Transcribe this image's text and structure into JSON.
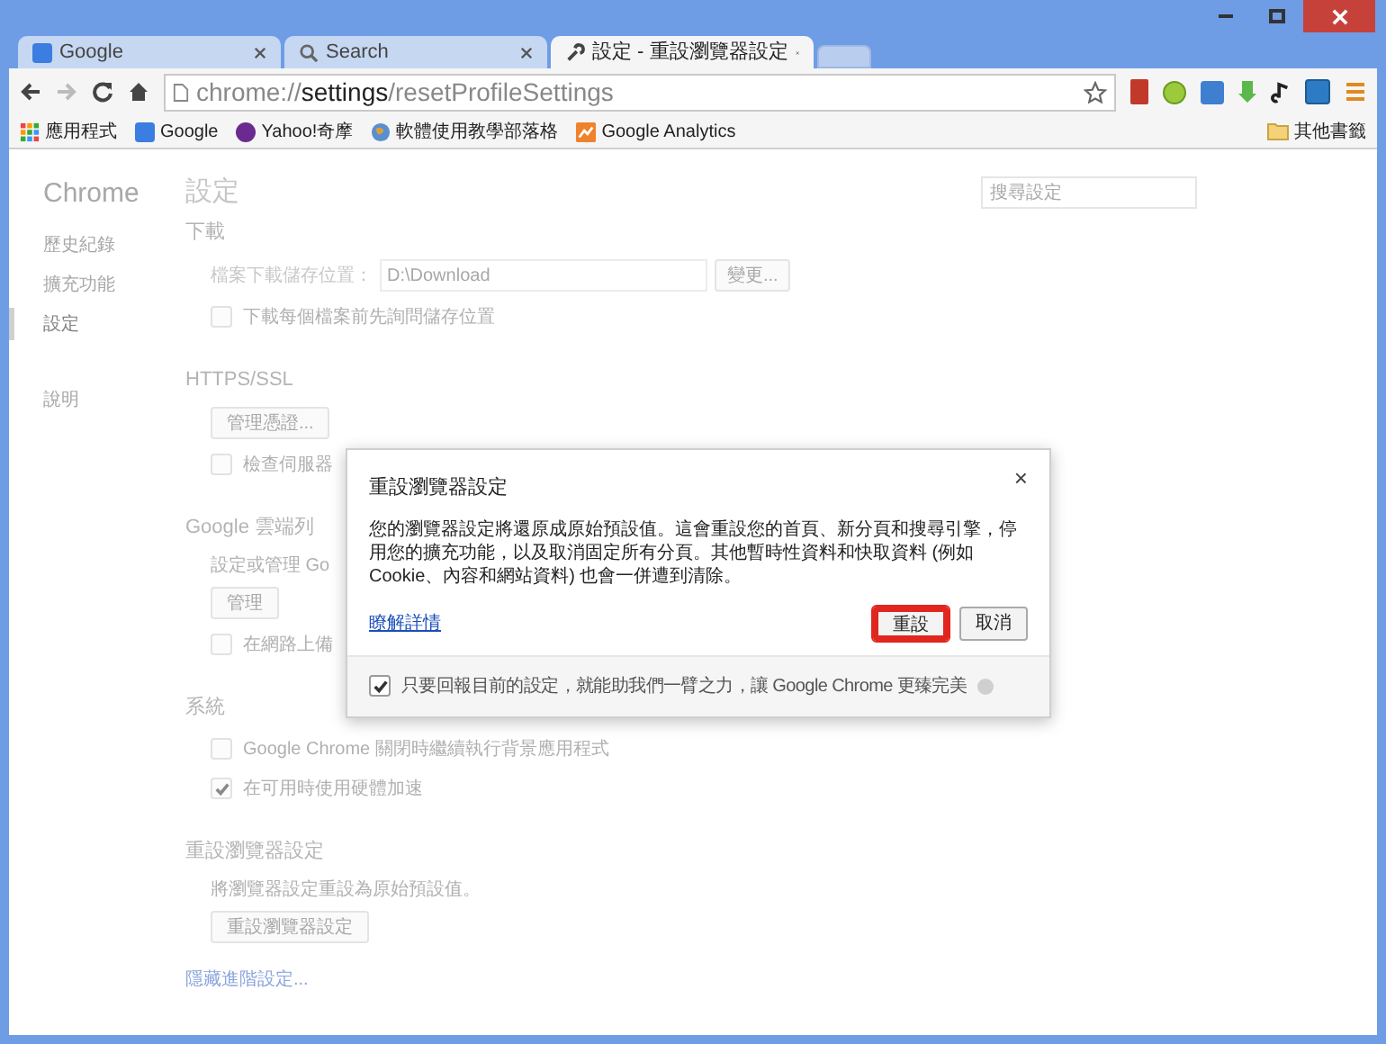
{
  "tabs": [
    {
      "title": "Google",
      "selected": false
    },
    {
      "title": "Search",
      "selected": false
    },
    {
      "title": "設定 - 重設瀏覽器設定",
      "selected": true
    }
  ],
  "toolbar": {
    "url_scheme": "chrome://",
    "url_host": "settings",
    "url_path": "/resetProfileSettings"
  },
  "bookmarks": [
    {
      "label": "應用程式"
    },
    {
      "label": "Google"
    },
    {
      "label": "Yahoo!奇摩"
    },
    {
      "label": "軟體使用教學部落格"
    },
    {
      "label": "Google Analytics"
    }
  ],
  "other_bookmarks": "其他書籤",
  "sidebar": {
    "title": "Chrome",
    "items": [
      {
        "label": "歷史紀錄",
        "selected": false
      },
      {
        "label": "擴充功能",
        "selected": false
      },
      {
        "label": "設定",
        "selected": true
      },
      {
        "label": "說明",
        "selected": false
      }
    ]
  },
  "main": {
    "title": "設定",
    "search_placeholder": "搜尋設定",
    "sections": [
      {
        "heading": "下載",
        "rows": [
          {
            "kind": "field",
            "label": "檔案下載儲存位置：",
            "value": "D:\\Download",
            "button": "變更..."
          },
          {
            "kind": "checkbox",
            "label": "下載每個檔案前先詢問儲存位置",
            "checked": false
          }
        ]
      },
      {
        "heading": "HTTPS/SSL",
        "rows": [
          {
            "kind": "button",
            "label": "管理憑證..."
          },
          {
            "kind": "checkbox",
            "label": "檢查伺服器",
            "checked": false
          }
        ]
      },
      {
        "heading": "Google 雲端列",
        "rows": [
          {
            "kind": "text",
            "label": "設定或管理 Go"
          },
          {
            "kind": "button",
            "label": "管理"
          },
          {
            "kind": "checkbox",
            "label": "在網路上備",
            "checked": false
          }
        ]
      },
      {
        "heading": "系統",
        "rows": [
          {
            "kind": "checkbox",
            "label": "Google Chrome 關閉時繼續執行背景應用程式",
            "checked": false
          },
          {
            "kind": "checkbox",
            "label": "在可用時使用硬體加速",
            "checked": true
          }
        ]
      },
      {
        "heading": "重設瀏覽器設定",
        "rows": [
          {
            "kind": "text",
            "label": "將瀏覽器設定重設為原始預設值。"
          },
          {
            "kind": "button",
            "label": "重設瀏覽器設定"
          }
        ]
      }
    ],
    "advanced_link": "隱藏進階設定..."
  },
  "dialog": {
    "title": "重設瀏覽器設定",
    "close": "×",
    "body": "您的瀏覽器設定將還原成原始預設值。這會重設您的首頁、新分頁和搜尋引擎，停用您的擴充功能，以及取消固定所有分頁。其他暫時性資料和快取資料 (例如 Cookie、內容和網站資料) 也會一併遭到清除。",
    "link": "瞭解詳情",
    "buttons": [
      {
        "label": "重設",
        "highlighted": true
      },
      {
        "label": "取消",
        "highlighted": false
      }
    ],
    "feedback": {
      "label": "只要回報目前的設定，就能助我們一臂之力，讓 Google Chrome 更臻完美",
      "checked": true
    }
  }
}
